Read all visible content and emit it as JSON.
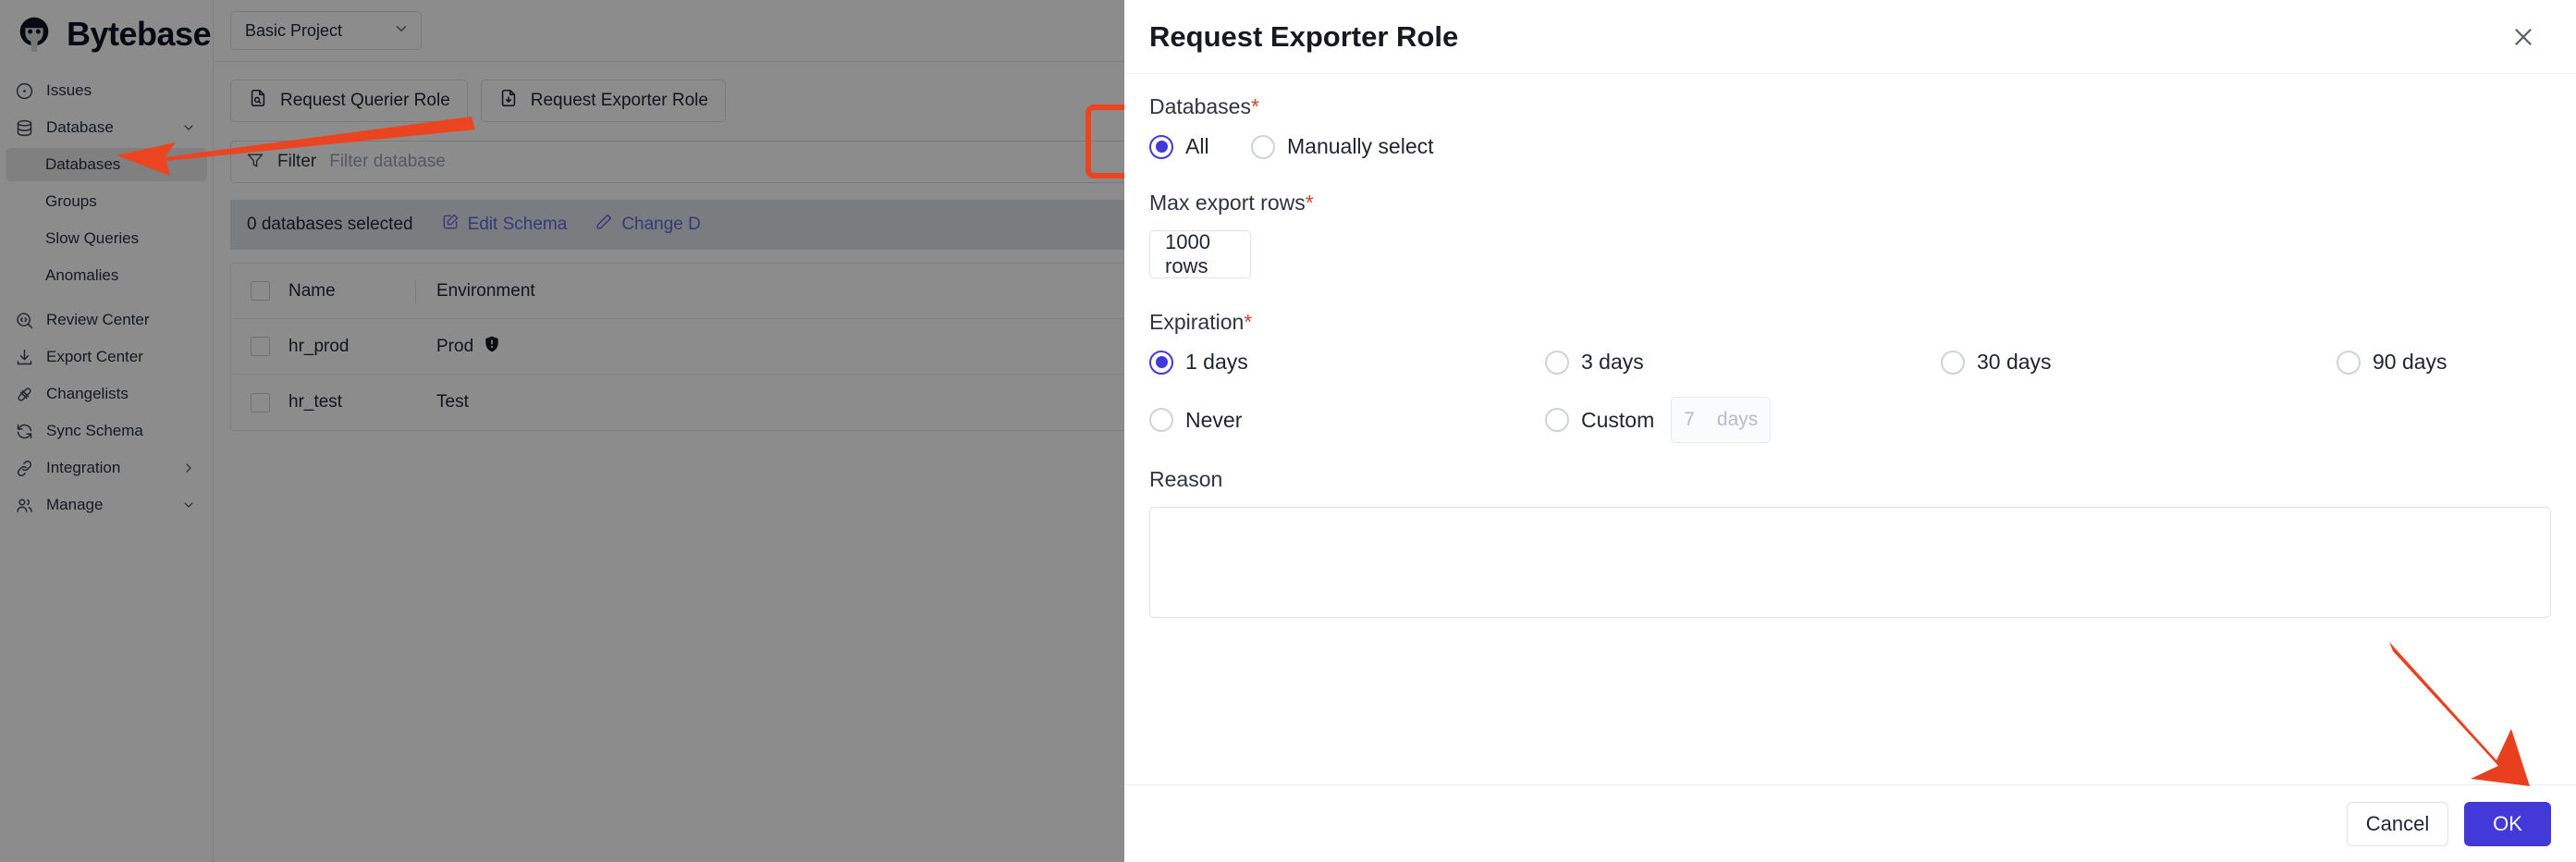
{
  "brand": {
    "name": "Bytebase",
    "logo_icon": "bytebase-logo-icon"
  },
  "sidebar": {
    "items": [
      {
        "label": "Issues",
        "icon": "circle-dot-icon",
        "type": "top",
        "chevron": ""
      },
      {
        "label": "Database",
        "icon": "database-icon",
        "type": "top",
        "chevron": "chevron-down-icon"
      },
      {
        "label": "Databases",
        "icon": "",
        "type": "sub",
        "active": true,
        "chevron": ""
      },
      {
        "label": "Groups",
        "icon": "",
        "type": "sub",
        "active": false,
        "chevron": ""
      },
      {
        "label": "Slow Queries",
        "icon": "",
        "type": "sub",
        "active": false,
        "chevron": ""
      },
      {
        "label": "Anomalies",
        "icon": "",
        "type": "sub",
        "active": false,
        "chevron": ""
      },
      {
        "label": "Review Center",
        "icon": "code-search-icon",
        "type": "top",
        "chevron": ""
      },
      {
        "label": "Export Center",
        "icon": "download-icon",
        "type": "top",
        "chevron": ""
      },
      {
        "label": "Changelists",
        "icon": "changelist-icon",
        "type": "top",
        "chevron": ""
      },
      {
        "label": "Sync Schema",
        "icon": "sync-icon",
        "type": "top",
        "chevron": ""
      },
      {
        "label": "Integration",
        "icon": "link-icon",
        "type": "top",
        "chevron": "chevron-right-icon"
      },
      {
        "label": "Manage",
        "icon": "users-icon",
        "type": "top",
        "chevron": "chevron-down-icon"
      }
    ]
  },
  "topbar": {
    "project_selected": "Basic Project",
    "project_chevron_icon": "chevron-down-icon"
  },
  "actions": {
    "request_querier": {
      "label": "Request Querier Role",
      "icon": "file-search-icon"
    },
    "request_exporter": {
      "label": "Request Exporter Role",
      "icon": "file-download-icon"
    }
  },
  "filter": {
    "label": "Filter",
    "placeholder": "Filter database",
    "icon": "funnel-icon"
  },
  "selection_bar": {
    "count_text": "0 databases selected",
    "edit_schema": {
      "label": "Edit Schema",
      "icon": "edit-square-icon"
    },
    "change_data": {
      "label": "Change D",
      "icon": "pencil-icon"
    }
  },
  "table": {
    "columns": [
      "Name",
      "Environment"
    ],
    "rows": [
      {
        "name": "hr_prod",
        "environment": "Prod",
        "badge_icon": "shield-alert-icon"
      },
      {
        "name": "hr_test",
        "environment": "Test",
        "badge_icon": ""
      }
    ]
  },
  "modal": {
    "title": "Request Exporter Role",
    "close_icon": "close-icon",
    "databases": {
      "label": "Databases",
      "required_mark": "*",
      "options": [
        {
          "label": "All",
          "selected": true
        },
        {
          "label": "Manually select",
          "selected": false
        }
      ]
    },
    "max_export_rows": {
      "label": "Max export rows",
      "required_mark": "*",
      "value": "1000 rows"
    },
    "expiration": {
      "label": "Expiration",
      "required_mark": "*",
      "options": [
        {
          "label": "1 days",
          "selected": true
        },
        {
          "label": "3 days",
          "selected": false
        },
        {
          "label": "30 days",
          "selected": false
        },
        {
          "label": "90 days",
          "selected": false
        },
        {
          "label": "Never",
          "selected": false
        },
        {
          "label": "Custom",
          "selected": false
        }
      ],
      "custom_value": "7",
      "custom_unit": "days"
    },
    "reason": {
      "label": "Reason",
      "value": ""
    },
    "footer": {
      "cancel_label": "Cancel",
      "ok_label": "OK"
    }
  },
  "annotations": {
    "accent_color": "#eb4420",
    "arrow_to_databases": "arrow-left-icon",
    "arrow_to_ok": "arrow-down-right-icon",
    "box_around": "request-exporter-role-button"
  },
  "colors": {
    "primary": "#4338d8",
    "annotation": "#eb4420",
    "link": "#6366e0",
    "required": "#d0452a"
  }
}
